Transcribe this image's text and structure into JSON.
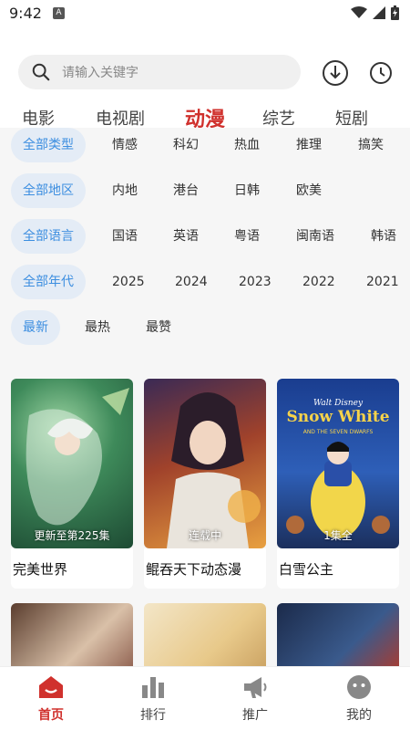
{
  "status_bar": {
    "time": "9:42",
    "app_icon_letter": "A"
  },
  "search": {
    "placeholder": "请输入关键字"
  },
  "tabs": [
    {
      "label": "电影"
    },
    {
      "label": "电视剧"
    },
    {
      "label": "动漫",
      "active": true
    },
    {
      "label": "综艺"
    },
    {
      "label": "短剧"
    }
  ],
  "filters": {
    "type": [
      "全部类型",
      "情感",
      "科幻",
      "热血",
      "推理",
      "搞笑"
    ],
    "region": [
      "全部地区",
      "内地",
      "港台",
      "日韩",
      "欧美"
    ],
    "language": [
      "全部语言",
      "国语",
      "英语",
      "粤语",
      "闽南语",
      "韩语"
    ],
    "year": [
      "全部年代",
      "2025",
      "2024",
      "2023",
      "2022",
      "2021"
    ],
    "sort": [
      "最新",
      "最热",
      "最赞"
    ]
  },
  "cards": [
    {
      "title": "完美世界",
      "badge": "更新至第225集"
    },
    {
      "title": "鲲吞天下动态漫",
      "badge": "连载中"
    },
    {
      "title": "白雪公主",
      "badge": "1集全",
      "poster_text": "Snow White",
      "poster_subtext": "AND THE SEVEN DWARFS",
      "poster_brand": "Walt Disney"
    }
  ],
  "nav": [
    {
      "label": "首页",
      "icon": "home-icon",
      "active": true
    },
    {
      "label": "排行",
      "icon": "ranking-icon"
    },
    {
      "label": "推广",
      "icon": "megaphone-icon"
    },
    {
      "label": "我的",
      "icon": "profile-icon"
    }
  ],
  "colors": {
    "accent": "#d0312d",
    "chip_text": "#3c8ee0",
    "chip_bg": "#e4ecf6"
  }
}
